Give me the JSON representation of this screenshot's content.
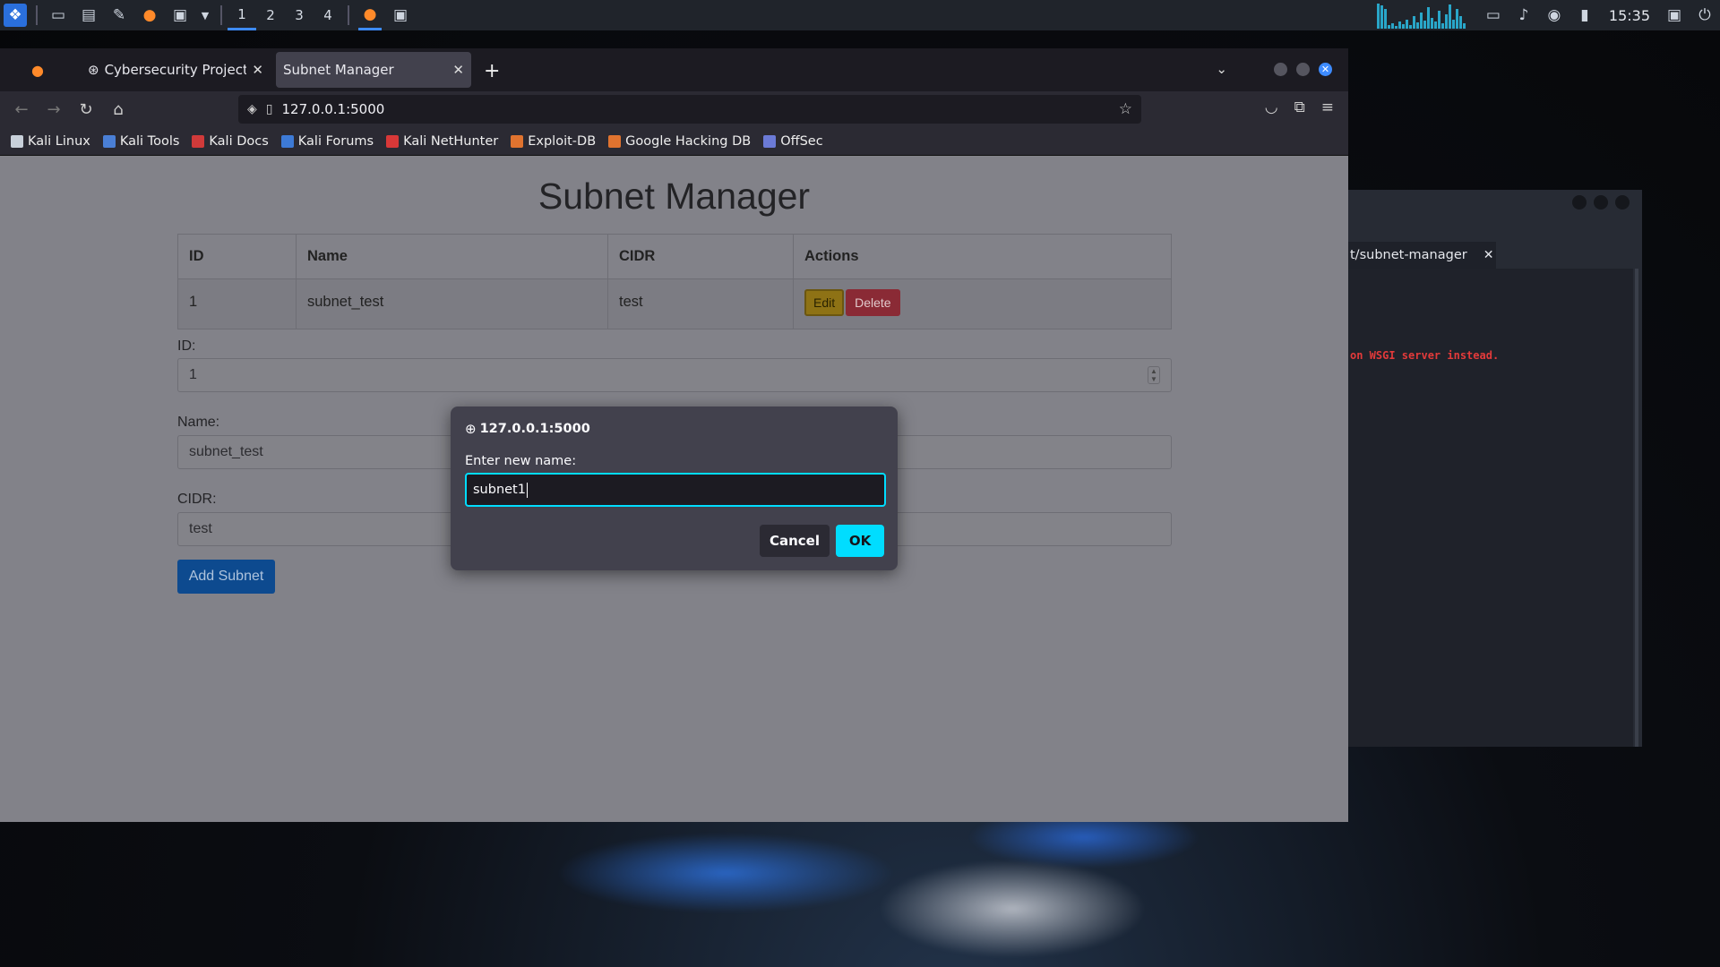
{
  "panel": {
    "workspaces": [
      "1",
      "2",
      "3",
      "4"
    ],
    "clock": "15:35"
  },
  "browser": {
    "tabs": [
      {
        "title": "Cybersecurity Project Ide"
      },
      {
        "title": "Subnet Manager"
      }
    ],
    "url": "127.0.0.1:5000",
    "bookmarks": [
      {
        "label": "Kali Linux",
        "color": "#c8d0da"
      },
      {
        "label": "Kali Tools",
        "color": "#4a7fd6"
      },
      {
        "label": "Kali Docs",
        "color": "#d03a3a"
      },
      {
        "label": "Kali Forums",
        "color": "#3d7ad6"
      },
      {
        "label": "Kali NetHunter",
        "color": "#d83838"
      },
      {
        "label": "Exploit-DB",
        "color": "#e0732f"
      },
      {
        "label": "Google Hacking DB",
        "color": "#e0732f"
      },
      {
        "label": "OffSec",
        "color": "#6b7ad6"
      }
    ]
  },
  "page": {
    "title": "Subnet Manager",
    "table": {
      "headers": [
        "ID",
        "Name",
        "CIDR",
        "Actions"
      ],
      "rows": [
        {
          "id": "1",
          "name": "subnet_test",
          "cidr": "test",
          "edit": "Edit",
          "delete": "Delete"
        }
      ]
    },
    "form": {
      "id_label": "ID:",
      "id_value": "1",
      "name_label": "Name:",
      "name_value": "subnet_test",
      "cidr_label": "CIDR:",
      "cidr_value": "test",
      "submit": "Add Subnet"
    }
  },
  "dialog": {
    "origin": "127.0.0.1:5000",
    "message": "Enter new name:",
    "input_value": "subnet1",
    "cancel": "Cancel",
    "ok": "OK"
  },
  "terminal": {
    "tab_title": "t/subnet-manager",
    "visible_line": "on WSGI server instead."
  },
  "colors": {
    "accent": "#00ddff",
    "edit_button": "#8e7215",
    "delete_button": "#8a2a35",
    "add_button": "#0d4a8f",
    "warning_text": "#e23a3a"
  }
}
